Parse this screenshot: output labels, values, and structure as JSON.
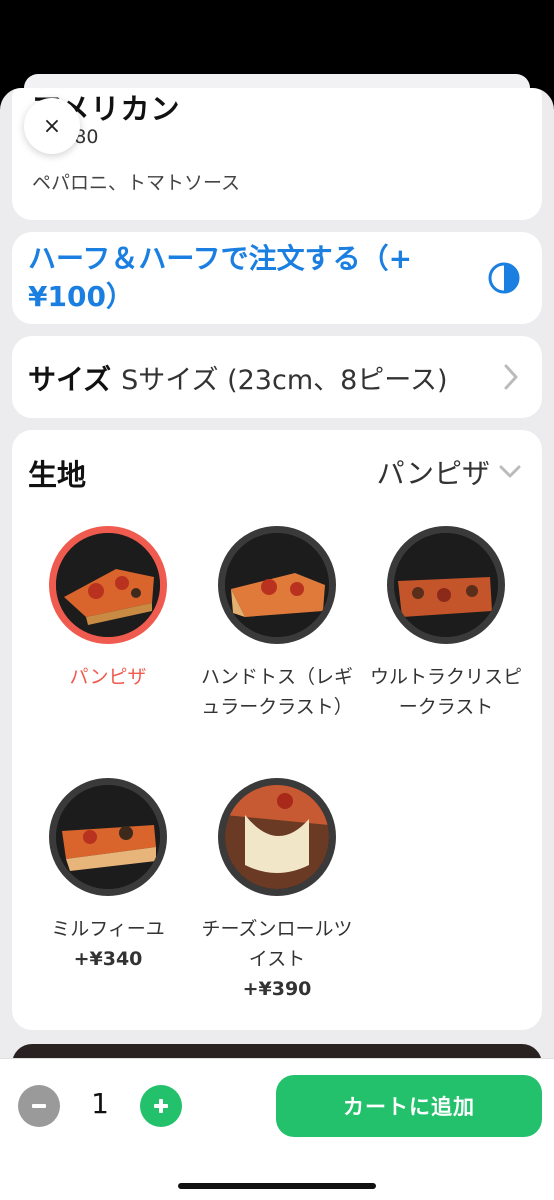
{
  "product": {
    "name": "アメリカン",
    "price": "¥1,680",
    "description": "ペパロニ、トマトソース"
  },
  "close": {
    "label": "×"
  },
  "half_and_half": {
    "label": "ハーフ＆ハーフで注文する（+¥100）"
  },
  "size": {
    "title": "サイズ",
    "value": "Sサイズ (23cm、8ピース)"
  },
  "crust": {
    "title": "生地",
    "selected": "パンピザ",
    "options": [
      {
        "name": "パンピザ",
        "price": "",
        "selected": true
      },
      {
        "name": "ハンドトス（レギュラークラスト）",
        "price": ""
      },
      {
        "name": "ウルトラクリスピークラスト",
        "price": ""
      },
      {
        "name": "ミルフィーユ",
        "price": "+¥340"
      },
      {
        "name": "チーズンロールツイスト",
        "price": "+¥390"
      }
    ]
  },
  "cart": {
    "quantity": "1",
    "add_label": "カートに追加"
  },
  "colors": {
    "accent_blue": "#1a7fe0",
    "selected_red": "#ef5b4e",
    "green": "#23c16b"
  },
  "icons": {
    "close": "close-icon",
    "half": "half-circle-icon",
    "size_chevron": "chevron-right-icon",
    "dropdown": "chevron-down-icon",
    "minus": "minus-icon",
    "plus": "plus-icon"
  }
}
